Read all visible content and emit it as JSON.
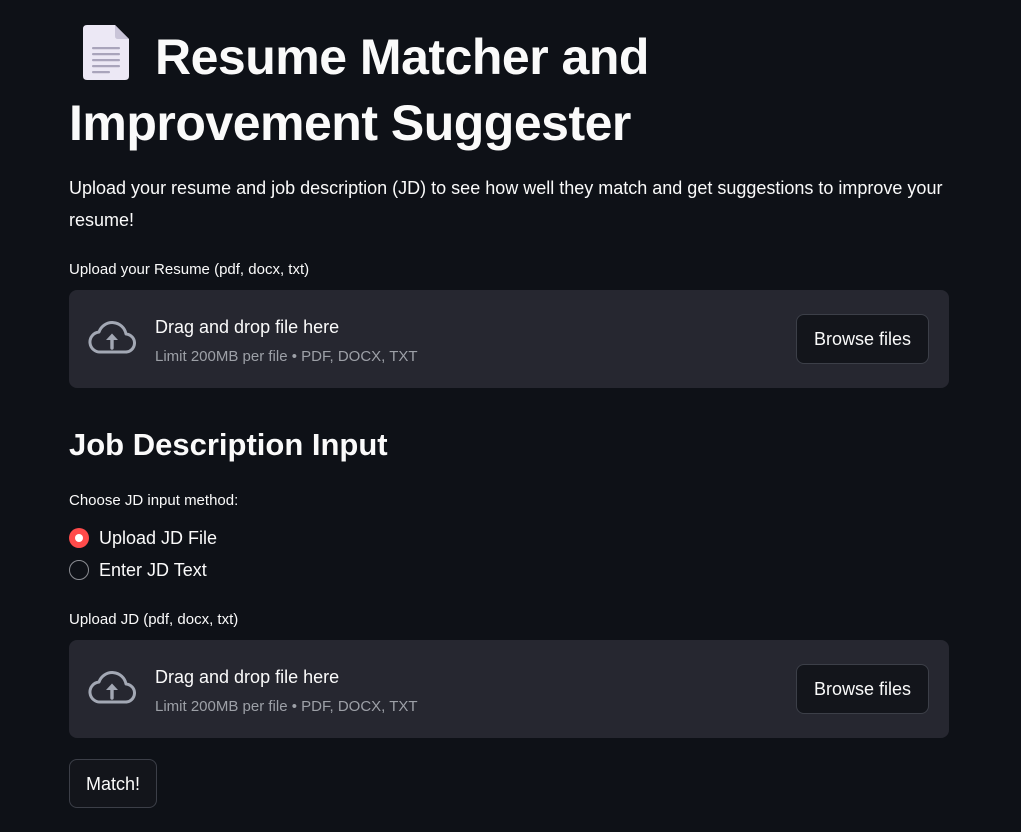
{
  "header": {
    "title": "Resume Matcher and Improvement Suggester",
    "title_icon": "document-icon",
    "description": "Upload your resume and job description (JD) to see how well they match and get suggestions to improve your resume!"
  },
  "resume_upload": {
    "label": "Upload your Resume (pdf, docx, txt)",
    "dropzone_title": "Drag and drop file here",
    "dropzone_limit": "Limit 200MB per file • PDF, DOCX, TXT",
    "browse_label": "Browse files",
    "icon": "cloud-upload-icon"
  },
  "jd_section": {
    "subheader": "Job Description Input",
    "method_label": "Choose JD input method:",
    "options": [
      {
        "label": "Upload JD File",
        "selected": true
      },
      {
        "label": "Enter JD Text",
        "selected": false
      }
    ]
  },
  "jd_upload": {
    "label": "Upload JD (pdf, docx, txt)",
    "dropzone_title": "Drag and drop file here",
    "dropzone_limit": "Limit 200MB per file • PDF, DOCX, TXT",
    "browse_label": "Browse files",
    "icon": "cloud-upload-icon"
  },
  "actions": {
    "match_label": "Match!"
  },
  "colors": {
    "background": "#0e1117",
    "panel": "#262730",
    "accent": "#ff4b4b",
    "text": "#fafafa",
    "muted_text": "#9da0a7"
  }
}
